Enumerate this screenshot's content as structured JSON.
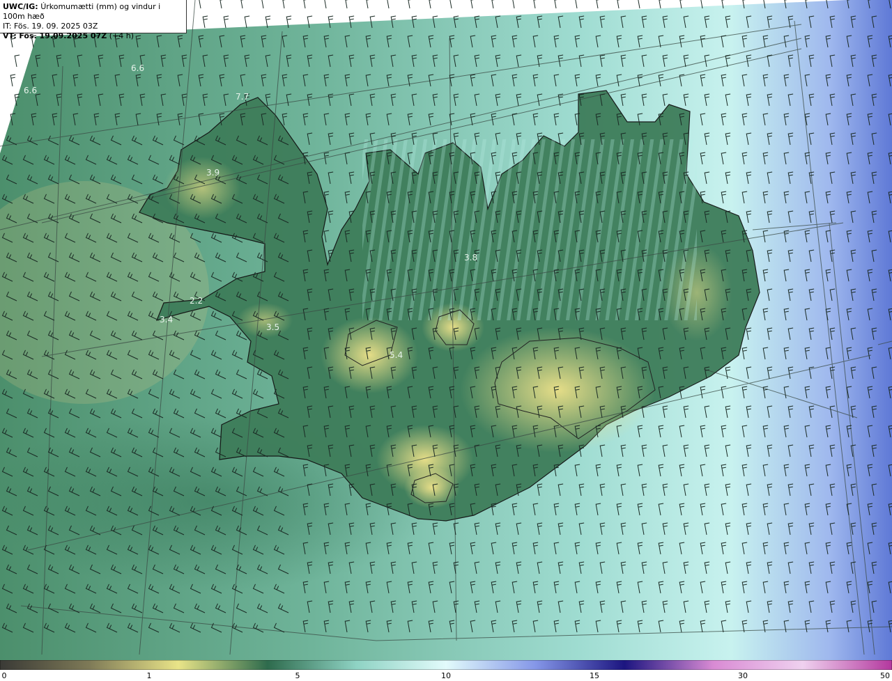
{
  "header": {
    "product": "UWC/IG:",
    "title": "Úrkomumætti (mm) og vindur i 100m hæð",
    "init_line": "IT: Fös. 19. 09. 2025 03Z",
    "valid_prefix": "VT:",
    "valid_time": "Fös. 19.09.2025 07Z",
    "lead": "(+4 h)"
  },
  "value_labels": [
    "6.6",
    "6.6",
    "7.7",
    "3.9",
    "3.8",
    "3.5",
    "5.4",
    "3.4",
    "2.2"
  ],
  "colorbar": {
    "ticks": [
      "0",
      "1",
      "5",
      "10",
      "15",
      "30",
      "50"
    ],
    "colors": [
      "#3a3a36",
      "#7e7a57",
      "#e9e488",
      "#2e6b4d",
      "#8fd3c4",
      "#e2fbfb",
      "#8597e8",
      "#1c1580",
      "#d98bd4",
      "#efd1ef",
      "#b3389e"
    ]
  },
  "map": {
    "background_colors": {
      "low": "#2f6b4d",
      "mid": "#9fd9cf",
      "high": "#f0e28a",
      "east": "#5f7bd8"
    },
    "coastline_color": "#111111",
    "grid_color": "#3a4a44",
    "barb_color": "#1a2a24"
  }
}
